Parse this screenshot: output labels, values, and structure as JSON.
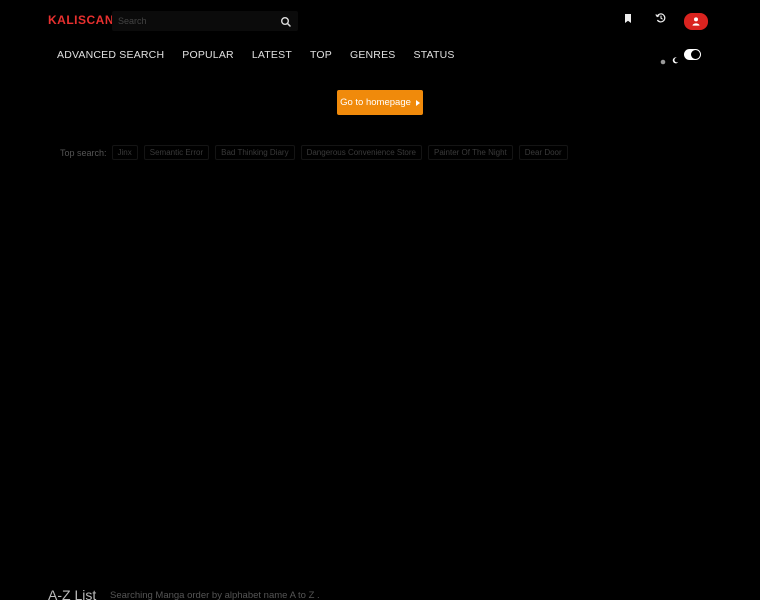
{
  "header": {
    "logo_part1": "KALI",
    "logo_part2": "SCAN",
    "search_placeholder": "Search",
    "icons": {
      "search": "search-icon",
      "bookmark": "bookmark-icon",
      "history": "history-icon",
      "user": "user-icon"
    },
    "accent_color": "#d9231f"
  },
  "nav": {
    "items": [
      "ADVANCED SEARCH",
      "POPULAR",
      "LATEST",
      "TOP",
      "GENRES",
      "STATUS"
    ]
  },
  "theme_toggle": {
    "sun_icon": "sun-icon",
    "moon_icon": "moon-icon",
    "state": "dark"
  },
  "main": {
    "home_button_label": "Go to homepage",
    "home_button_color": "#f08a0b",
    "top_search_label": "Top search:",
    "top_search_tags": [
      "Jinx",
      "Semantic Error",
      "Bad Thinking Diary",
      "Dangerous Convenience Store",
      "Painter Of The Night",
      "Dear Door"
    ]
  },
  "az_list": {
    "title": "A-Z List",
    "subtitle": "Searching Manga order by alphabet name A to Z ."
  }
}
